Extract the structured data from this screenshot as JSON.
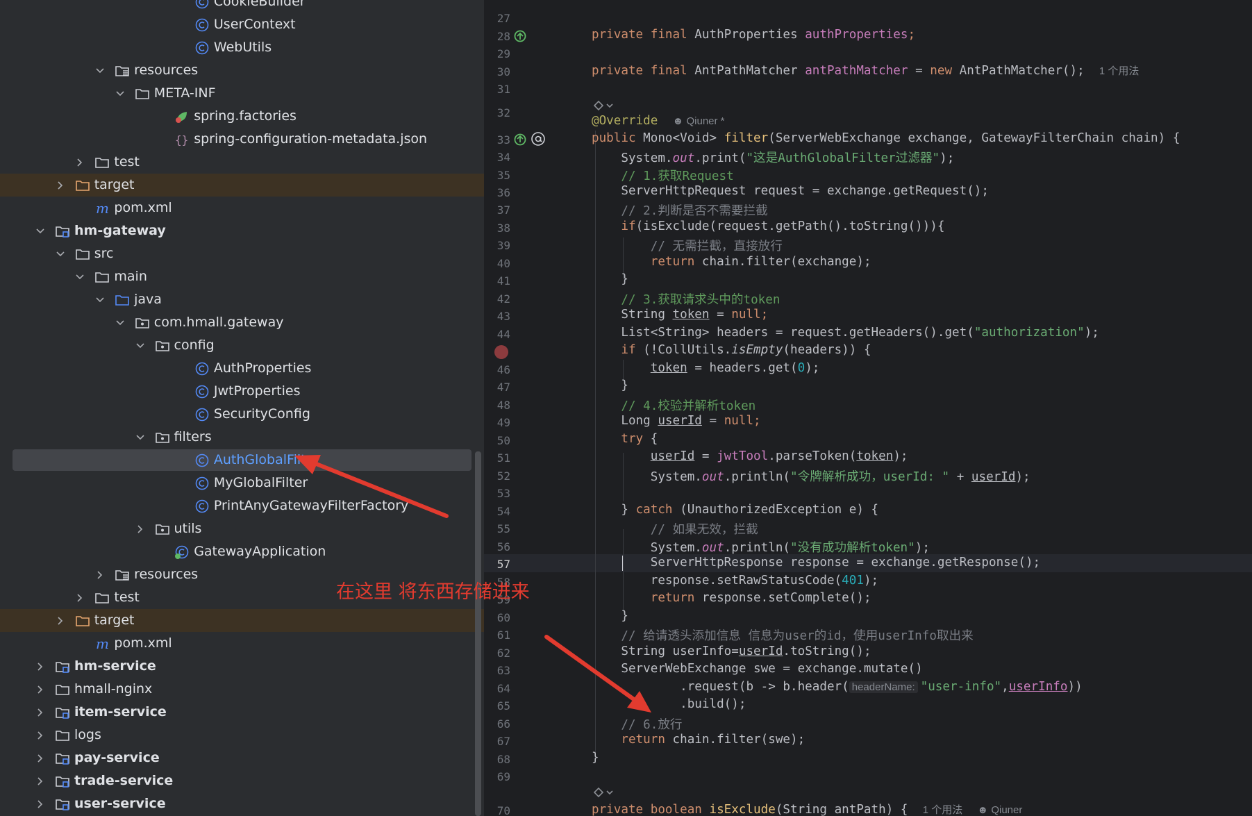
{
  "tree": {
    "rows": [
      {
        "label": "CookieBuilder",
        "icon": "class-icon"
      },
      {
        "label": "UserContext",
        "icon": "class-icon"
      },
      {
        "label": "WebUtils",
        "icon": "class-icon"
      },
      {
        "label": "resources",
        "icon": "resources-folder-icon"
      },
      {
        "label": "META-INF",
        "icon": "folder-icon"
      },
      {
        "label": "spring.factories",
        "icon": "spring-file-icon"
      },
      {
        "label": "spring-configuration-metadata.json",
        "icon": "json-icon"
      },
      {
        "label": "test",
        "icon": "folder-icon"
      },
      {
        "label": "target",
        "icon": "excluded-folder-icon"
      },
      {
        "label": "pom.xml",
        "icon": "maven-icon"
      },
      {
        "label": "hm-gateway",
        "icon": "module-icon"
      },
      {
        "label": "src",
        "icon": "folder-icon"
      },
      {
        "label": "main",
        "icon": "folder-icon"
      },
      {
        "label": "java",
        "icon": "source-folder-icon"
      },
      {
        "label": "com.hmall.gateway",
        "icon": "package-icon"
      },
      {
        "label": "config",
        "icon": "package-icon"
      },
      {
        "label": "AuthProperties",
        "icon": "class-icon"
      },
      {
        "label": "JwtProperties",
        "icon": "class-icon"
      },
      {
        "label": "SecurityConfig",
        "icon": "class-icon"
      },
      {
        "label": "filters",
        "icon": "package-icon"
      },
      {
        "label": "AuthGlobalFilter",
        "icon": "class-icon"
      },
      {
        "label": "MyGlobalFilter",
        "icon": "class-icon"
      },
      {
        "label": "PrintAnyGatewayFilterFactory",
        "icon": "class-icon"
      },
      {
        "label": "utils",
        "icon": "package-icon"
      },
      {
        "label": "GatewayApplication",
        "icon": "spring-boot-class-icon"
      },
      {
        "label": "resources",
        "icon": "resources-folder-icon"
      },
      {
        "label": "test",
        "icon": "folder-icon"
      },
      {
        "label": "target",
        "icon": "excluded-folder-icon"
      },
      {
        "label": "pom.xml",
        "icon": "maven-icon"
      },
      {
        "label": "hm-service",
        "icon": "module-icon"
      },
      {
        "label": "hmall-nginx",
        "icon": "folder-icon"
      },
      {
        "label": "item-service",
        "icon": "module-icon"
      },
      {
        "label": "logs",
        "icon": "folder-icon"
      },
      {
        "label": "pay-service",
        "icon": "module-icon"
      },
      {
        "label": "trade-service",
        "icon": "module-icon"
      },
      {
        "label": "user-service",
        "icon": "module-icon"
      }
    ],
    "selected": "AuthGlobalFilter"
  },
  "annotation": {
    "note": "在这里 将东西存储进来",
    "color": "#e23b2f"
  },
  "editor": {
    "current_line": "57",
    "lines": [
      {
        "n": "27"
      },
      {
        "n": "28"
      },
      {
        "n": "29"
      },
      {
        "n": "30"
      },
      {
        "n": "31"
      },
      {
        "n": "32"
      },
      {
        "n": "33"
      },
      {
        "n": "34"
      },
      {
        "n": "35"
      },
      {
        "n": "36"
      },
      {
        "n": "37"
      },
      {
        "n": "38"
      },
      {
        "n": "39"
      },
      {
        "n": "40"
      },
      {
        "n": "41"
      },
      {
        "n": "42"
      },
      {
        "n": "43"
      },
      {
        "n": "44"
      },
      {
        "n": "46"
      },
      {
        "n": "47"
      },
      {
        "n": "48"
      },
      {
        "n": "49"
      },
      {
        "n": "50"
      },
      {
        "n": "51"
      },
      {
        "n": "52"
      },
      {
        "n": "53"
      },
      {
        "n": "54"
      },
      {
        "n": "55"
      },
      {
        "n": "56"
      },
      {
        "n": "57"
      },
      {
        "n": "58"
      },
      {
        "n": "59"
      },
      {
        "n": "60"
      },
      {
        "n": "61"
      },
      {
        "n": "62"
      },
      {
        "n": "63"
      },
      {
        "n": "64"
      },
      {
        "n": "65"
      },
      {
        "n": "66"
      },
      {
        "n": "67"
      },
      {
        "n": "68"
      },
      {
        "n": "69"
      },
      {
        "n": "70"
      }
    ],
    "code": {
      "l28": {
        "kw": "private final",
        "type": "AuthProperties",
        "field": "authProperties"
      },
      "l30": {
        "kw": "private final",
        "type": "AntPathMatcher",
        "field": "antPathMatcher",
        "assign": "=",
        "new_kw": "new",
        "ctor": "AntPathMatcher();",
        "hint": "1 个用法"
      },
      "l32": {
        "anno": "@Override",
        "author": "Qiuner *"
      },
      "l33": {
        "kw": "public",
        "ret": "Mono<Void>",
        "fn": "filter",
        "params": "(ServerWebExchange exchange, GatewayFilterChain chain) {"
      },
      "l34": {
        "pre": "System.",
        "out": "out",
        "mid": ".print(",
        "str": "\"这是AuthGlobalFilter过滤器\"",
        "end": ");"
      },
      "l35": {
        "cmt": "// 1.获取Request"
      },
      "l36": {
        "text": "ServerHttpRequest request = exchange.getRequest();"
      },
      "l37": {
        "cmt": "// 2.判断是否不需要拦截"
      },
      "l38": {
        "kw": "if",
        "text": "(isExclude(request.getPath().toString())){"
      },
      "l39": {
        "cmt": "// 无需拦截，直接放行"
      },
      "l40": {
        "kw": "return",
        "text": "chain.filter(exchange);"
      },
      "l41": {
        "text": "}"
      },
      "l42": {
        "cmt": "// 3.获取请求头中的token"
      },
      "l43": {
        "type": "String",
        "var": "token",
        "eq": "=",
        "kw": "null;"
      },
      "l44": {
        "pre": "List<String> headers = request.getHeaders().get(",
        "str": "\"authorization\"",
        "end": ");"
      },
      "l45": {
        "kw": "if",
        "pre": "(!CollUtils.",
        "it": "isEmpty",
        "end": "(headers)) {"
      },
      "l46": {
        "var": "token",
        "mid": "= headers.get(",
        "num": "0",
        "end": ");"
      },
      "l47": {
        "text": "}"
      },
      "l48": {
        "cmt": "// 4.校验并解析token"
      },
      "l49": {
        "type": "Long",
        "var": "userId",
        "eq": "=",
        "kw": "null;"
      },
      "l50": {
        "kw": "try",
        "text": "{"
      },
      "l51": {
        "var": "userId",
        "eq": "=",
        "fd": "jwtTool",
        "mid": ".parseToken(",
        "arg": "token",
        "end": ");"
      },
      "l52": {
        "pre": "System.",
        "out": "out",
        "mid": ".println(",
        "str": "\"令牌解析成功，userId: \"",
        "plus": "+",
        "var": "userId",
        "end": ");"
      },
      "l54": {
        "close": "}",
        "kw": "catch",
        "text": "(UnauthorizedException e) {"
      },
      "l55": {
        "cmt": "// 如果无效，拦截"
      },
      "l56": {
        "pre": "System.",
        "out": "out",
        "mid": ".println(",
        "str": "\"没有成功解析token\"",
        "end": ");"
      },
      "l57": {
        "text": "ServerHttpResponse response = exchange.getResponse();"
      },
      "l58": {
        "pre": "response.setRawStatusCode(",
        "num": "401",
        "end": ");"
      },
      "l59": {
        "kw": "return",
        "text": "response.setComplete();"
      },
      "l60": {
        "text": "}"
      },
      "l61": {
        "cmt": "// 给请透头添加信息 信息为user的id，使用userInfo取出来"
      },
      "l62": {
        "pre": "String userInfo=",
        "var": "userId",
        "end": ".toString();"
      },
      "l63": {
        "text": "ServerWebExchange swe = exchange.mutate()"
      },
      "l64": {
        "pre": ".request(b -> b.header(",
        "inlay": "headerName:",
        "str": "\"user-info\"",
        "comma": ",",
        "var": "userInfo",
        "end": "))"
      },
      "l65": {
        "text": ".build();"
      },
      "l66": {
        "cmt": "// 6.放行"
      },
      "l67": {
        "kw": "return",
        "text": "chain.filter(swe);"
      },
      "l68": {
        "text": "}"
      },
      "l70": {
        "kw": "private boolean",
        "fn": "isExclude",
        "params": "(String antPath) {",
        "hint": "1 个用法",
        "author": "Qiuner"
      }
    }
  },
  "colors": {
    "panel_bg": "#2b2d30",
    "editor_bg": "#1e1f22",
    "excluded_bg": "#3d3223",
    "selection": "#43454a",
    "keyword": "#cf8e6d",
    "string": "#6aab73",
    "field": "#c77dbb",
    "comment": "#7a7e85",
    "accent": "#5e9fff"
  }
}
